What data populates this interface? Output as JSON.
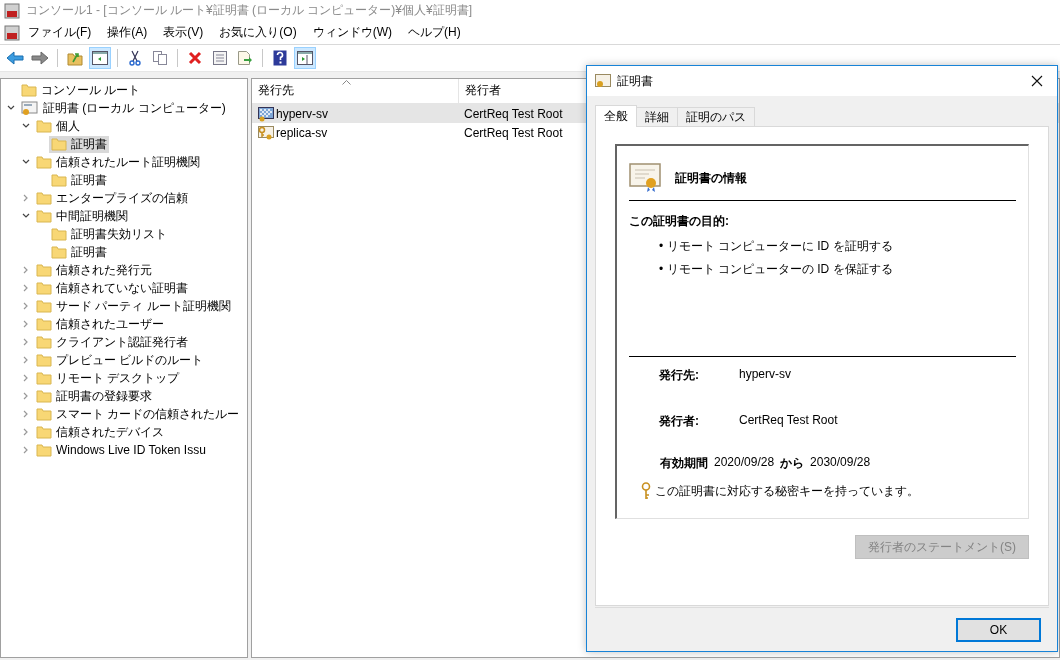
{
  "window": {
    "title": "コンソール1 - [コンソール ルート¥証明書 (ローカル コンピューター)¥個人¥証明書]"
  },
  "menu": [
    "ファイル(F)",
    "操作(A)",
    "表示(V)",
    "お気に入り(O)",
    "ウィンドウ(W)",
    "ヘルプ(H)"
  ],
  "toolbar": [
    {
      "kind": "back",
      "pressed": false
    },
    {
      "kind": "forward",
      "pressed": false
    },
    {
      "kind": "sep"
    },
    {
      "kind": "up",
      "pressed": false
    },
    {
      "kind": "tree",
      "pressed": true
    },
    {
      "kind": "sep"
    },
    {
      "kind": "cut",
      "pressed": false
    },
    {
      "kind": "copy",
      "pressed": false
    },
    {
      "kind": "sep"
    },
    {
      "kind": "delete",
      "pressed": false
    },
    {
      "kind": "properties",
      "pressed": false
    },
    {
      "kind": "export",
      "pressed": false
    },
    {
      "kind": "sep"
    },
    {
      "kind": "help",
      "pressed": false
    },
    {
      "kind": "pane",
      "pressed": true
    }
  ],
  "tree": [
    {
      "label": "コンソール ルート",
      "kind": "folder",
      "selected": false,
      "children": [
        {
          "label": "証明書 (ローカル コンピューター)",
          "kind": "store",
          "expanded": true,
          "selected": false,
          "children": [
            {
              "label": "個人",
              "kind": "folder",
              "expanded": true,
              "selected": false,
              "children": [
                {
                  "label": "証明書",
                  "kind": "folder",
                  "selected": true
                }
              ]
            },
            {
              "label": "信頼されたルート証明機関",
              "kind": "folder",
              "expanded": true,
              "selected": false,
              "children": [
                {
                  "label": "証明書",
                  "kind": "folder",
                  "selected": false
                }
              ]
            },
            {
              "label": "エンタープライズの信頼",
              "kind": "folder",
              "expanded": false,
              "selected": false
            },
            {
              "label": "中間証明機関",
              "kind": "folder",
              "expanded": true,
              "selected": false,
              "children": [
                {
                  "label": "証明書失効リスト",
                  "kind": "folder",
                  "selected": false
                },
                {
                  "label": "証明書",
                  "kind": "folder",
                  "selected": false
                }
              ]
            },
            {
              "label": "信頼された発行元",
              "kind": "folder",
              "expanded": false,
              "selected": false
            },
            {
              "label": "信頼されていない証明書",
              "kind": "folder",
              "expanded": false,
              "selected": false
            },
            {
              "label": "サード パーティ ルート証明機関",
              "kind": "folder",
              "expanded": false,
              "selected": false
            },
            {
              "label": "信頼されたユーザー",
              "kind": "folder",
              "expanded": false,
              "selected": false
            },
            {
              "label": "クライアント認証発行者",
              "kind": "folder",
              "expanded": false,
              "selected": false
            },
            {
              "label": "プレビュー ビルドのルート",
              "kind": "folder",
              "expanded": false,
              "selected": false
            },
            {
              "label": "リモート デスクトップ",
              "kind": "folder",
              "expanded": false,
              "selected": false
            },
            {
              "label": "証明書の登録要求",
              "kind": "folder",
              "expanded": false,
              "selected": false
            },
            {
              "label": "スマート カードの信頼されたルー",
              "kind": "folder",
              "expanded": false,
              "selected": false
            },
            {
              "label": "信頼されたデバイス",
              "kind": "folder",
              "expanded": false,
              "selected": false
            },
            {
              "label": "Windows Live ID Token Issu",
              "kind": "folder",
              "expanded": false,
              "selected": false
            }
          ]
        }
      ]
    }
  ],
  "list": {
    "columns": [
      {
        "label": "発行先",
        "sorted": true
      },
      {
        "label": "発行者",
        "sorted": false
      }
    ],
    "rows": [
      {
        "kind": "checkered",
        "issued_to": "hyperv-sv",
        "issued_by": "CertReq Test Root",
        "selected": true
      },
      {
        "kind": "key",
        "issued_to": "replica-sv",
        "issued_by": "CertReq Test Root",
        "selected": false
      }
    ]
  },
  "dialog": {
    "title": "証明書",
    "tabs": [
      {
        "label": "全般",
        "selected": true
      },
      {
        "label": "詳細",
        "selected": false
      },
      {
        "label": "証明のパス",
        "selected": false
      }
    ],
    "info_title": "証明書の情報",
    "purpose_heading": "この証明書の目的:",
    "purposes": [
      "• リモート コンピューターに ID を証明する",
      "• リモート コンピューターの ID を保証する"
    ],
    "fields": [
      {
        "label": "発行先:",
        "value": "hyperv-sv"
      },
      {
        "label": "発行者:",
        "value": "CertReq Test Root"
      }
    ],
    "validity": {
      "label": "有効期間",
      "from": "2020/09/28",
      "connector": "から",
      "to": "2030/09/28"
    },
    "private_key_note": "この証明書に対応する秘密キーを持っています。",
    "statement_button": {
      "label": "発行者のステートメント(S)",
      "disabled": true
    },
    "ok_button": "OK"
  }
}
